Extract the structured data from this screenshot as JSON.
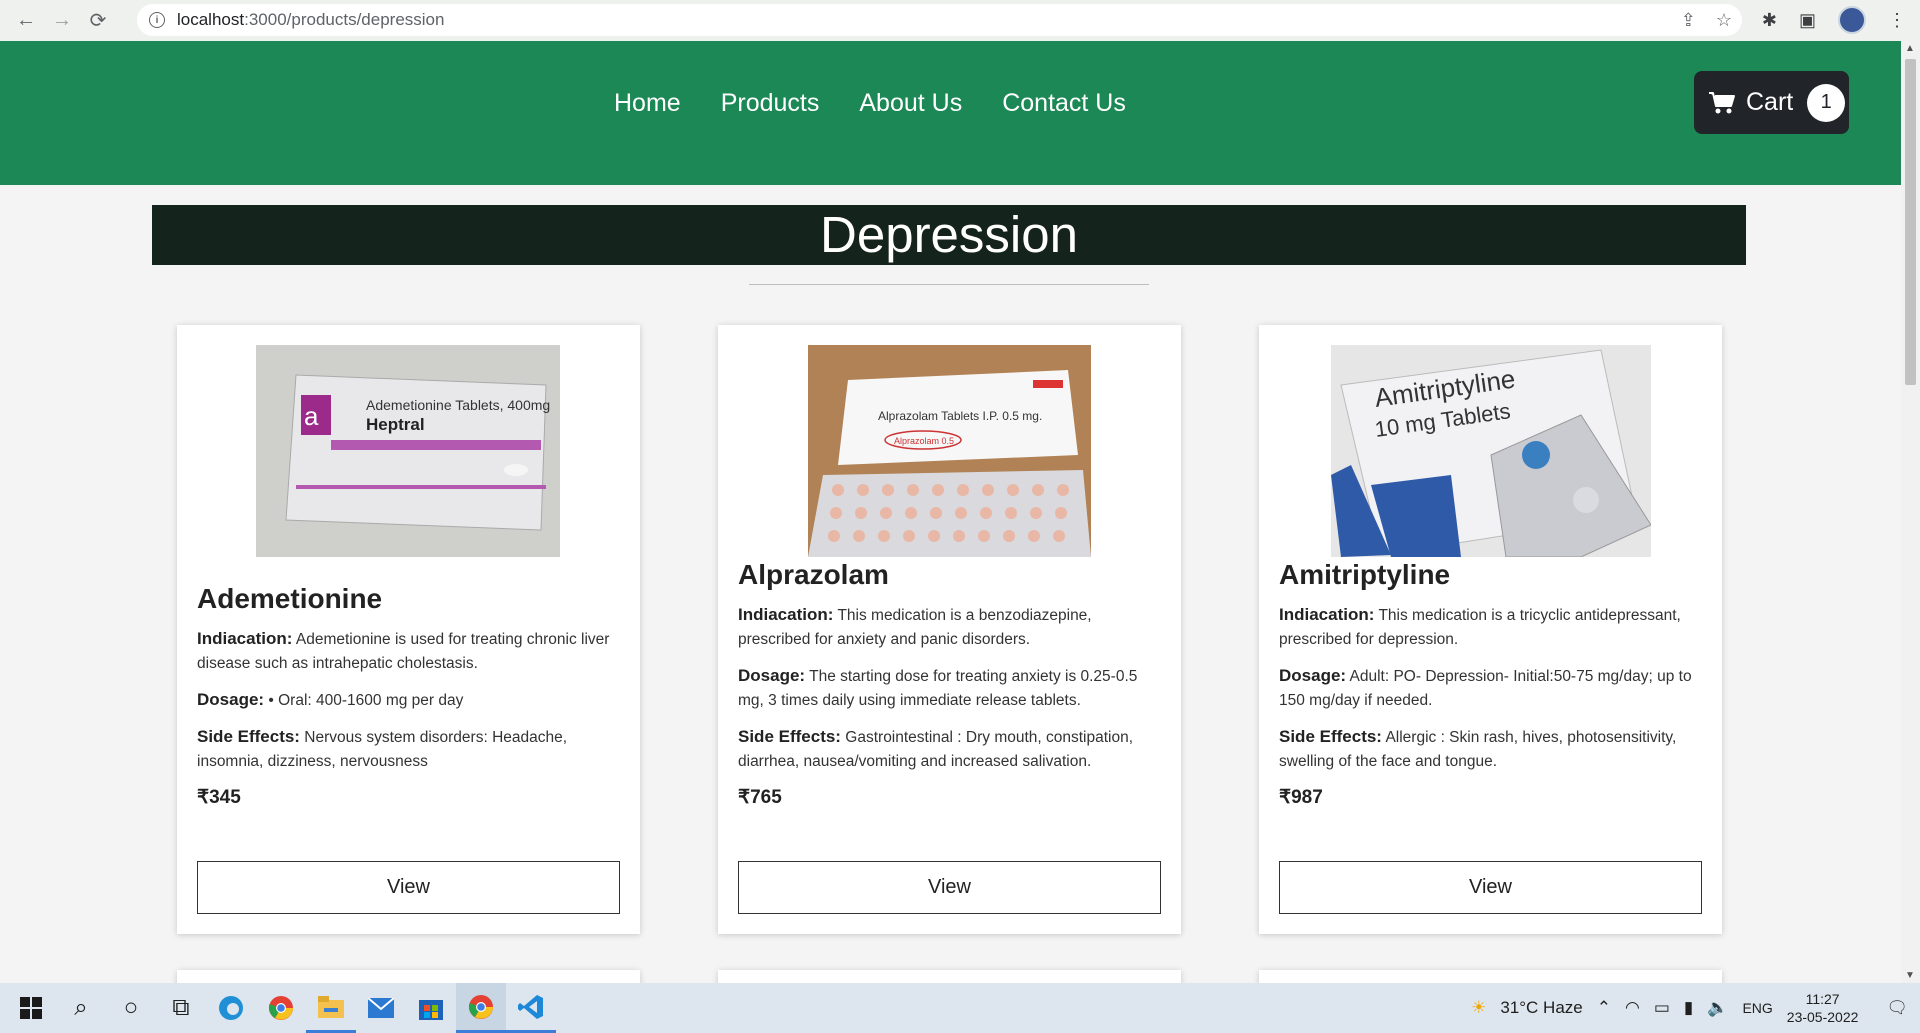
{
  "browser": {
    "url_host": "localhost",
    "url_path": ":3000/products/depression"
  },
  "nav": {
    "items": [
      "Home",
      "Products",
      "About Us",
      "Contact Us"
    ],
    "cart_label": "Cart",
    "cart_count": "1"
  },
  "page": {
    "title": "Depression"
  },
  "products": [
    {
      "name": "Ademetionine",
      "image_icon": "ademetionine-box-image",
      "indication_label": "Indiacation:",
      "indication": "Ademetionine is used for treating chronic liver disease such as intrahepatic cholestasis.",
      "dosage_label": "Dosage:",
      "dosage": "• Oral: 400-1600 mg per day",
      "side_effects_label": "Side Effects:",
      "side_effects": "Nervous system disorders: Headache, insomnia, dizziness, nervousness",
      "price": "₹345",
      "button": "View",
      "img_text1": "Ademetionine Tablets, 400mg",
      "img_text2": "Heptral"
    },
    {
      "name": "Alprazolam",
      "image_icon": "alprazolam-strip-image",
      "indication_label": "Indiacation:",
      "indication": "This medication is a benzodiazepine, prescribed for anxiety and panic disorders.",
      "dosage_label": "Dosage:",
      "dosage": "The starting dose for treating anxiety is 0.25-0.5 mg, 3 times daily using immediate release tablets.",
      "side_effects_label": "Side Effects:",
      "side_effects": "Gastrointestinal : Dry mouth, constipation, diarrhea, nausea/vomiting and increased salivation.",
      "price": "₹765",
      "button": "View",
      "img_text1": "Alprazolam Tablets I.P. 0.5 mg.",
      "img_text2": "Alprazolam 0.5"
    },
    {
      "name": "Amitriptyline",
      "image_icon": "amitriptyline-box-image",
      "indication_label": "Indiacation:",
      "indication": "This medication is a tricyclic antidepressant, prescribed for depression.",
      "dosage_label": "Dosage:",
      "dosage": "Adult: PO- Depression- Initial:50-75 mg/day; up to 150 mg/day if needed.",
      "side_effects_label": "Side Effects:",
      "side_effects": "Allergic : Skin rash, hives, photosensitivity, swelling of the face and tongue.",
      "price": "₹987",
      "button": "View",
      "img_text1": "Amitriptyline",
      "img_text2": "10 mg Tablets"
    }
  ],
  "taskbar": {
    "weather": "31°C  Haze",
    "lang": "ENG",
    "time": "11:27",
    "date": "23-05-2022"
  },
  "colors": {
    "header_green": "#1b8856",
    "title_bar": "#14231b",
    "cart_dark": "#212529"
  }
}
